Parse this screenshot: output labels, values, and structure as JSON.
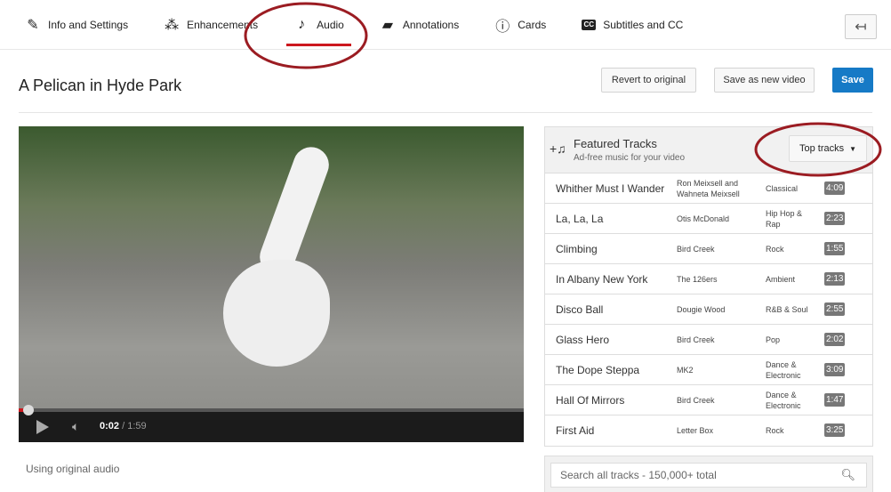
{
  "tabs": [
    {
      "label": "Info and Settings",
      "icon": "pencil-icon"
    },
    {
      "label": "Enhancements",
      "icon": "magic-wand-icon"
    },
    {
      "label": "Audio",
      "icon": "music-note-icon",
      "active": true
    },
    {
      "label": "Annotations",
      "icon": "speech-bubble-icon"
    },
    {
      "label": "Cards",
      "icon": "info-icon"
    },
    {
      "label": "Subtitles and CC",
      "icon": "cc-icon"
    }
  ],
  "header": {
    "title": "A Pelican in Hyde Park",
    "revert": "Revert to original",
    "save_new": "Save as new video",
    "save": "Save"
  },
  "player": {
    "current": "0:02",
    "separator": " / ",
    "duration": "1:59",
    "progress_percent": 2
  },
  "status": "Using original audio",
  "panel": {
    "title": "Featured Tracks",
    "subtitle": "Ad-free music for your video",
    "dropdown": "Top tracks",
    "tracks": [
      {
        "name": "Whither Must I Wander",
        "artist": "Ron Meixsell and Wahneta Meixsell",
        "genre": "Classical",
        "duration": "4:09"
      },
      {
        "name": "La, La, La",
        "artist": "Otis McDonald",
        "genre": "Hip Hop & Rap",
        "duration": "2:23"
      },
      {
        "name": "Climbing",
        "artist": "Bird Creek",
        "genre": "Rock",
        "duration": "1:55"
      },
      {
        "name": "In Albany New York",
        "artist": "The 126ers",
        "genre": "Ambient",
        "duration": "2:13"
      },
      {
        "name": "Disco Ball",
        "artist": "Dougie Wood",
        "genre": "R&B & Soul",
        "duration": "2:55"
      },
      {
        "name": "Glass Hero",
        "artist": "Bird Creek",
        "genre": "Pop",
        "duration": "2:02"
      },
      {
        "name": "The Dope Steppa",
        "artist": "MK2",
        "genre": "Dance & Electronic",
        "duration": "3:09"
      },
      {
        "name": "Hall Of Mirrors",
        "artist": "Bird Creek",
        "genre": "Dance & Electronic",
        "duration": "1:47"
      },
      {
        "name": "First Aid",
        "artist": "Letter Box",
        "genre": "Rock",
        "duration": "3:25"
      }
    ]
  },
  "search": {
    "placeholder": "Search all tracks - 150,000+ total"
  },
  "colors": {
    "accent": "#cc181e",
    "save": "#167ac6",
    "annotation": "#9b1c22"
  }
}
